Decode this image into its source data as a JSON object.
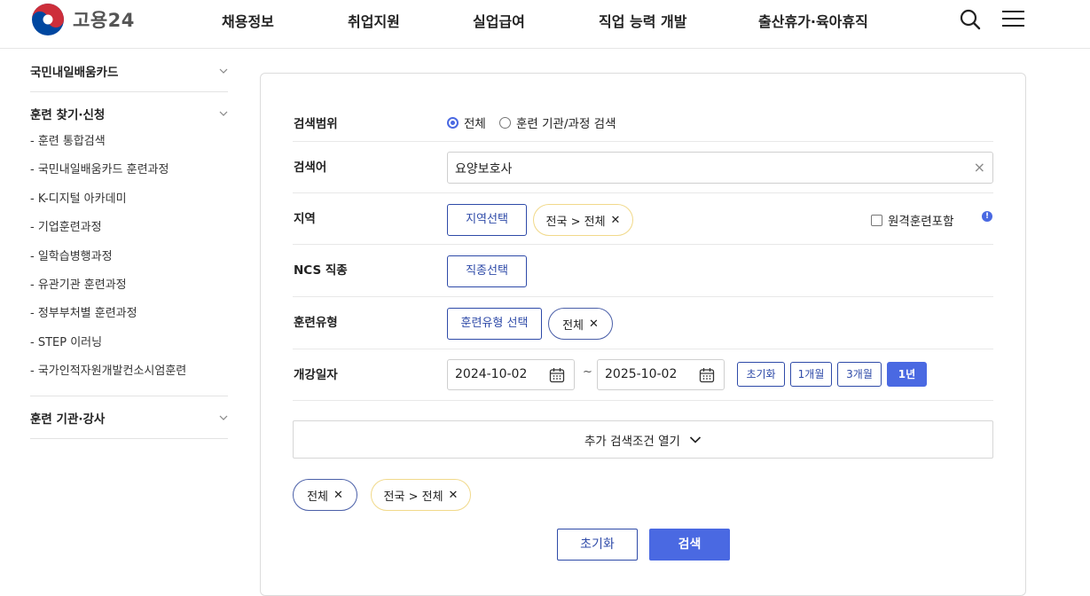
{
  "header": {
    "logo_text": "고용24",
    "nav": [
      "채용정보",
      "취업지원",
      "실업급여",
      "직업 능력 개발",
      "출산휴가·육아휴직"
    ]
  },
  "sidebar": {
    "groups": [
      {
        "label": "국민내일배움카드",
        "items": []
      },
      {
        "label": "훈련 찾기·신청",
        "items": [
          "- 훈련 통합검색",
          "- 국민내일배움카드 훈련과정",
          "- K-디지털 아카데미",
          "- 기업훈련과정",
          "- 일학습병행과정",
          "- 유관기관 훈련과정",
          "- 정부부처별 훈련과정",
          "- STEP 이러닝",
          "- 국가인적자원개발컨소시엄훈련"
        ]
      },
      {
        "label": "훈련 기관·강사",
        "items": []
      }
    ]
  },
  "form": {
    "scope": {
      "label": "검색범위",
      "options": [
        "전체",
        "훈련 기관/과정 검색"
      ],
      "selected": "전체"
    },
    "keyword": {
      "label": "검색어",
      "value": "요양보호사",
      "clear_icon": "×"
    },
    "region": {
      "label": "지역",
      "button": "지역선택",
      "chip": "전국 > 전체",
      "remote_label": "원격훈련포함",
      "info_icon": "!"
    },
    "ncs": {
      "label": "NCS 직종",
      "button": "직종선택"
    },
    "train_type": {
      "label": "훈련유형",
      "button": "훈련유형 선택",
      "chip": "전체"
    },
    "date": {
      "label": "개강일자",
      "start": "2024-10-02",
      "tilde": "~",
      "end": "2025-10-02",
      "presets": [
        "초기화",
        "1개월",
        "3개월",
        "1년"
      ],
      "active_preset": "1년"
    },
    "more_label": "추가 검색조건 열기",
    "selected_chips": [
      "전체",
      "전국 > 전체"
    ],
    "reset_button": "초기화",
    "search_button": "검색"
  },
  "colors": {
    "accent": "#4a69e2",
    "navy": "#2e4aa8",
    "chip_yellow_border": "#f1d98a",
    "logo_red": "#cd2e3a",
    "logo_blue": "#0047a0"
  }
}
